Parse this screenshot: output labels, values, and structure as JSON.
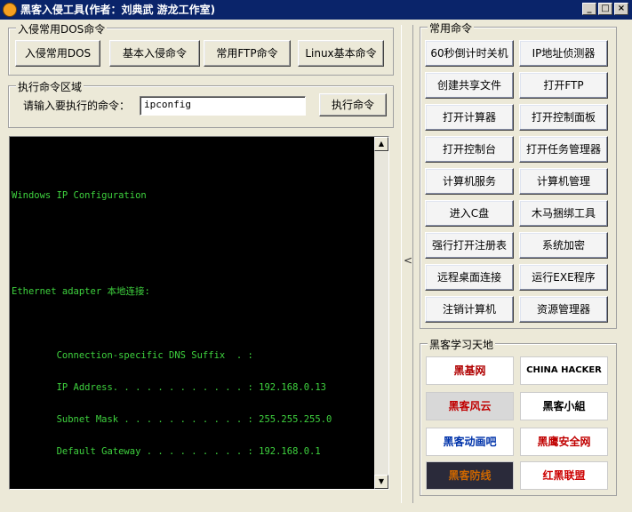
{
  "window": {
    "title": "黑客入侵工具(作者：刘典武 游龙工作室)",
    "buttons": [
      "_",
      "□",
      "×"
    ]
  },
  "dos_group": {
    "title": "入侵常用DOS命令",
    "buttons": [
      "入侵常用DOS",
      "基本入侵命令",
      "常用FTP命令",
      "Linux基本命令"
    ]
  },
  "exec_group": {
    "title": "执行命令区域",
    "prompt_label": "请输入要执行的命令：",
    "command_value": "ipconfig",
    "run_button": "执行命令"
  },
  "console": {
    "lines": [
      "",
      "Windows IP Configuration",
      "",
      "",
      "Ethernet adapter 本地连接:",
      "",
      "        Connection-specific DNS Suffix  . :",
      "        IP Address. . . . . . . . . . . . : 192.168.0.13",
      "        Subnet Mask . . . . . . . . . . . : 255.255.255.0",
      "        Default Gateway . . . . . . . . . : 192.168.0.1"
    ]
  },
  "splitter": {
    "arrow": "<"
  },
  "common_cmds": {
    "title": "常用命令",
    "buttons": [
      "60秒倒计时关机",
      "IP地址侦测器",
      "创建共享文件",
      "打开FTP",
      "打开计算器",
      "打开控制面板",
      "打开控制台",
      "打开任务管理器",
      "计算机服务",
      "计算机管理",
      "进入C盘",
      "木马捆绑工具",
      "强行打开注册表",
      "系统加密",
      "远程桌面连接",
      "运行EXE程序",
      "注销计算机",
      "资源管理器"
    ]
  },
  "hacker_sites": {
    "title": "黑客学习天地",
    "logos": [
      {
        "name": "hackbase-logo",
        "text": "黑基网",
        "fg": "#b00000",
        "bg": "#ffffff"
      },
      {
        "name": "china-hacker-logo",
        "text": "CHINA HACKER",
        "fg": "#000000",
        "bg": "#ffffff"
      },
      {
        "name": "hacker-style-logo",
        "text": "黑客风云",
        "fg": "#c00000",
        "bg": "#d8d8d8"
      },
      {
        "name": "hacker-group-logo",
        "text": "黑客小組",
        "fg": "#000000",
        "bg": "#ffffff"
      },
      {
        "name": "hack58-logo",
        "text": "黑客动画吧",
        "fg": "#0033aa",
        "bg": "#ffffff"
      },
      {
        "name": "3800hk-logo",
        "text": "黑鹰安全网",
        "fg": "#c00000",
        "bg": "#ffffff"
      },
      {
        "name": "black-defense-logo",
        "text": "黑客防线",
        "fg": "#cc6600",
        "bg": "#2a2a3a"
      },
      {
        "name": "red-black-alliance-logo",
        "text": "红黑联盟",
        "fg": "#cc0000",
        "bg": "#ffffff"
      }
    ]
  }
}
